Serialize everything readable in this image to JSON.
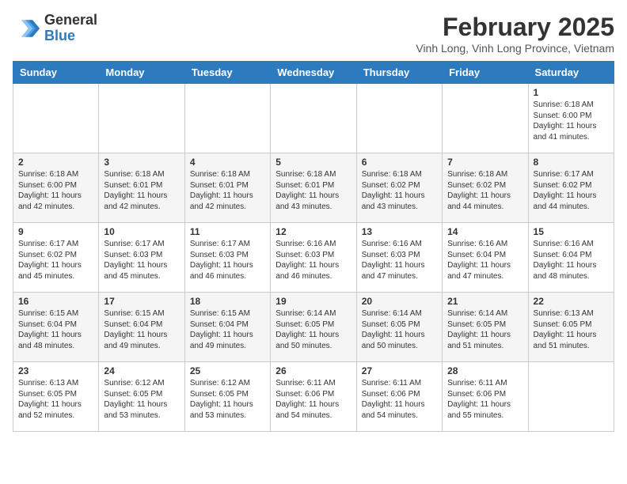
{
  "header": {
    "logo_general": "General",
    "logo_blue": "Blue",
    "month_year": "February 2025",
    "location": "Vinh Long, Vinh Long Province, Vietnam"
  },
  "weekdays": [
    "Sunday",
    "Monday",
    "Tuesday",
    "Wednesday",
    "Thursday",
    "Friday",
    "Saturday"
  ],
  "weeks": [
    [
      {
        "day": "",
        "info": ""
      },
      {
        "day": "",
        "info": ""
      },
      {
        "day": "",
        "info": ""
      },
      {
        "day": "",
        "info": ""
      },
      {
        "day": "",
        "info": ""
      },
      {
        "day": "",
        "info": ""
      },
      {
        "day": "1",
        "info": "Sunrise: 6:18 AM\nSunset: 6:00 PM\nDaylight: 11 hours\nand 41 minutes."
      }
    ],
    [
      {
        "day": "2",
        "info": "Sunrise: 6:18 AM\nSunset: 6:00 PM\nDaylight: 11 hours\nand 42 minutes."
      },
      {
        "day": "3",
        "info": "Sunrise: 6:18 AM\nSunset: 6:01 PM\nDaylight: 11 hours\nand 42 minutes."
      },
      {
        "day": "4",
        "info": "Sunrise: 6:18 AM\nSunset: 6:01 PM\nDaylight: 11 hours\nand 42 minutes."
      },
      {
        "day": "5",
        "info": "Sunrise: 6:18 AM\nSunset: 6:01 PM\nDaylight: 11 hours\nand 43 minutes."
      },
      {
        "day": "6",
        "info": "Sunrise: 6:18 AM\nSunset: 6:02 PM\nDaylight: 11 hours\nand 43 minutes."
      },
      {
        "day": "7",
        "info": "Sunrise: 6:18 AM\nSunset: 6:02 PM\nDaylight: 11 hours\nand 44 minutes."
      },
      {
        "day": "8",
        "info": "Sunrise: 6:17 AM\nSunset: 6:02 PM\nDaylight: 11 hours\nand 44 minutes."
      }
    ],
    [
      {
        "day": "9",
        "info": "Sunrise: 6:17 AM\nSunset: 6:02 PM\nDaylight: 11 hours\nand 45 minutes."
      },
      {
        "day": "10",
        "info": "Sunrise: 6:17 AM\nSunset: 6:03 PM\nDaylight: 11 hours\nand 45 minutes."
      },
      {
        "day": "11",
        "info": "Sunrise: 6:17 AM\nSunset: 6:03 PM\nDaylight: 11 hours\nand 46 minutes."
      },
      {
        "day": "12",
        "info": "Sunrise: 6:16 AM\nSunset: 6:03 PM\nDaylight: 11 hours\nand 46 minutes."
      },
      {
        "day": "13",
        "info": "Sunrise: 6:16 AM\nSunset: 6:03 PM\nDaylight: 11 hours\nand 47 minutes."
      },
      {
        "day": "14",
        "info": "Sunrise: 6:16 AM\nSunset: 6:04 PM\nDaylight: 11 hours\nand 47 minutes."
      },
      {
        "day": "15",
        "info": "Sunrise: 6:16 AM\nSunset: 6:04 PM\nDaylight: 11 hours\nand 48 minutes."
      }
    ],
    [
      {
        "day": "16",
        "info": "Sunrise: 6:15 AM\nSunset: 6:04 PM\nDaylight: 11 hours\nand 48 minutes."
      },
      {
        "day": "17",
        "info": "Sunrise: 6:15 AM\nSunset: 6:04 PM\nDaylight: 11 hours\nand 49 minutes."
      },
      {
        "day": "18",
        "info": "Sunrise: 6:15 AM\nSunset: 6:04 PM\nDaylight: 11 hours\nand 49 minutes."
      },
      {
        "day": "19",
        "info": "Sunrise: 6:14 AM\nSunset: 6:05 PM\nDaylight: 11 hours\nand 50 minutes."
      },
      {
        "day": "20",
        "info": "Sunrise: 6:14 AM\nSunset: 6:05 PM\nDaylight: 11 hours\nand 50 minutes."
      },
      {
        "day": "21",
        "info": "Sunrise: 6:14 AM\nSunset: 6:05 PM\nDaylight: 11 hours\nand 51 minutes."
      },
      {
        "day": "22",
        "info": "Sunrise: 6:13 AM\nSunset: 6:05 PM\nDaylight: 11 hours\nand 51 minutes."
      }
    ],
    [
      {
        "day": "23",
        "info": "Sunrise: 6:13 AM\nSunset: 6:05 PM\nDaylight: 11 hours\nand 52 minutes."
      },
      {
        "day": "24",
        "info": "Sunrise: 6:12 AM\nSunset: 6:05 PM\nDaylight: 11 hours\nand 53 minutes."
      },
      {
        "day": "25",
        "info": "Sunrise: 6:12 AM\nSunset: 6:05 PM\nDaylight: 11 hours\nand 53 minutes."
      },
      {
        "day": "26",
        "info": "Sunrise: 6:11 AM\nSunset: 6:06 PM\nDaylight: 11 hours\nand 54 minutes."
      },
      {
        "day": "27",
        "info": "Sunrise: 6:11 AM\nSunset: 6:06 PM\nDaylight: 11 hours\nand 54 minutes."
      },
      {
        "day": "28",
        "info": "Sunrise: 6:11 AM\nSunset: 6:06 PM\nDaylight: 11 hours\nand 55 minutes."
      },
      {
        "day": "",
        "info": ""
      }
    ]
  ]
}
